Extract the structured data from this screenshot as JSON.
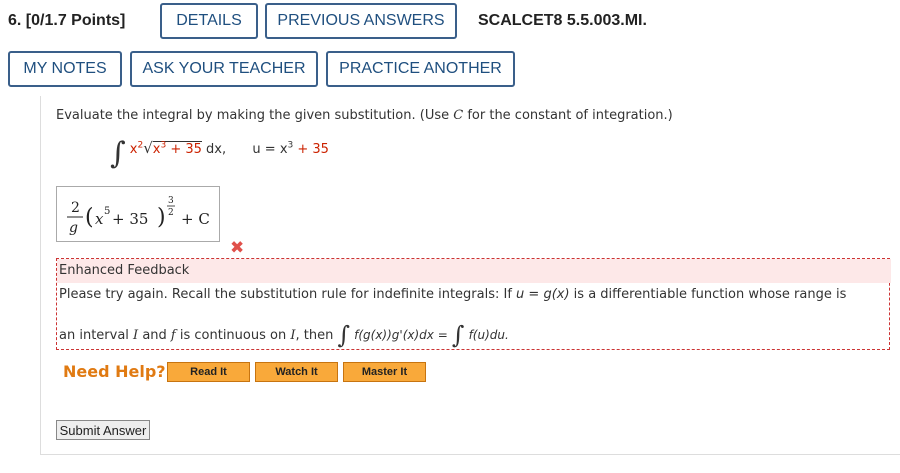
{
  "header": {
    "question_number": "6.",
    "points": "[0/1.7 Points]",
    "details_label": "DETAILS",
    "previous_answers_label": "PREVIOUS ANSWERS",
    "problem_code": "SCALCET8 5.5.003.MI."
  },
  "toolbar": {
    "my_notes_label": "MY NOTES",
    "ask_teacher_label": "ASK YOUR TEACHER",
    "practice_another_label": "PRACTICE ANOTHER"
  },
  "question": {
    "prompt_before": "Evaluate the integral by making the given substitution. (Use ",
    "prompt_var": "C",
    "prompt_after": " for the constant of integration.)",
    "integrand_lhs": "x",
    "integrand_pow": "2",
    "integrand_root_body": "x",
    "integrand_root_pow": "3",
    "integrand_root_const": " + 35",
    "dx": " dx,",
    "sub_lhs": "u = x",
    "sub_pow": "3",
    "sub_rhs": " + 35"
  },
  "answer": {
    "num": "2",
    "den": "g",
    "inner_var": "x",
    "inner_pow": "5",
    "inner_rest": " + 35",
    "exp_num": "3",
    "exp_den": "2",
    "constant": "+ C",
    "status_icon": "x-mark-icon",
    "status_color": "#e0504a"
  },
  "feedback": {
    "title": "Enhanced Feedback",
    "line1_a": "Please try again. Recall the substitution rule for indefinite integrals: If ",
    "line1_eq": "u = g(x)",
    "line1_b": " is a differentiable function whose range is",
    "line2_a": "an interval ",
    "line2_I": "I",
    "line2_b": " and ",
    "line2_f": "f",
    "line2_c": " is continuous on ",
    "line2_I2": "I",
    "line2_d": ", then ",
    "integral_left": "f(g(x))g'(x)dx =",
    "integral_right": "f(u)du."
  },
  "help": {
    "label": "Need Help?",
    "read_label": "Read It",
    "watch_label": "Watch It",
    "master_label": "Master It"
  },
  "submit_label": "Submit Answer"
}
